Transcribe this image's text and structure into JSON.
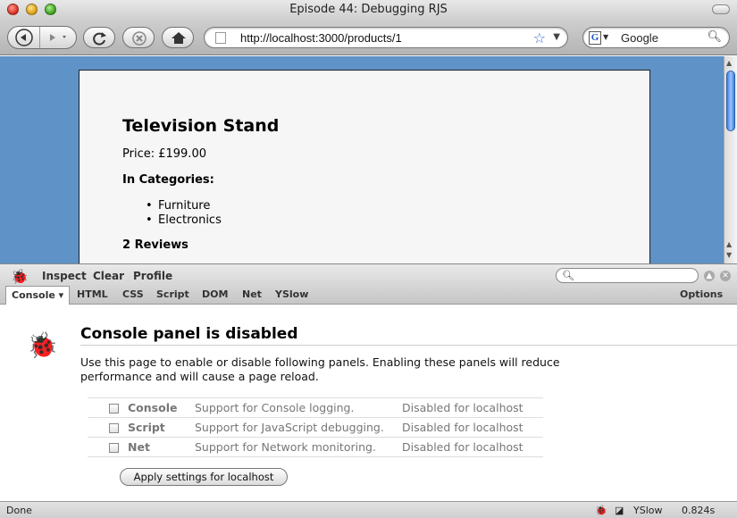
{
  "window": {
    "title": "Episode 44: Debugging RJS"
  },
  "toolbar": {
    "url": "http://localhost:3000/products/1",
    "search_placeholder": "Google",
    "search_engine_letter": "G",
    "icons": {
      "back": "back-arrow-icon",
      "forward": "forward-arrow-icon",
      "reload": "reload-icon",
      "stop": "stop-icon",
      "home": "home-icon",
      "bookmark": "star-icon"
    }
  },
  "page": {
    "product_title": "Television Stand",
    "price": "Price: £199.00",
    "categories_heading": "In Categories:",
    "categories": [
      "Furniture",
      "Electronics"
    ],
    "reviews_heading": "2 Reviews"
  },
  "firebug": {
    "toolbar_items": [
      "Inspect",
      "Clear",
      "Profile"
    ],
    "tabs": [
      "Console",
      "HTML",
      "CSS",
      "Script",
      "DOM",
      "Net",
      "YSlow"
    ],
    "active_tab": "Console",
    "options_label": "Options",
    "panel_title": "Console panel is disabled",
    "description": "Use this page to enable or disable following panels. Enabling these panels will reduce performance and will cause a page reload.",
    "panels": [
      {
        "name": "Console",
        "description": "Support for Console logging.",
        "status": "Disabled for localhost"
      },
      {
        "name": "Script",
        "description": "Support for JavaScript debugging.",
        "status": "Disabled for localhost"
      },
      {
        "name": "Net",
        "description": "Support for Network monitoring.",
        "status": "Disabled for localhost"
      }
    ],
    "apply_button": "Apply settings for localhost"
  },
  "status": {
    "text": "Done",
    "yslow": "YSlow",
    "time": "0.824s"
  },
  "colors": {
    "page_background": "#5f92c6",
    "card_background": "#f6f6f6",
    "accent_blue": "#3d7fe0"
  }
}
